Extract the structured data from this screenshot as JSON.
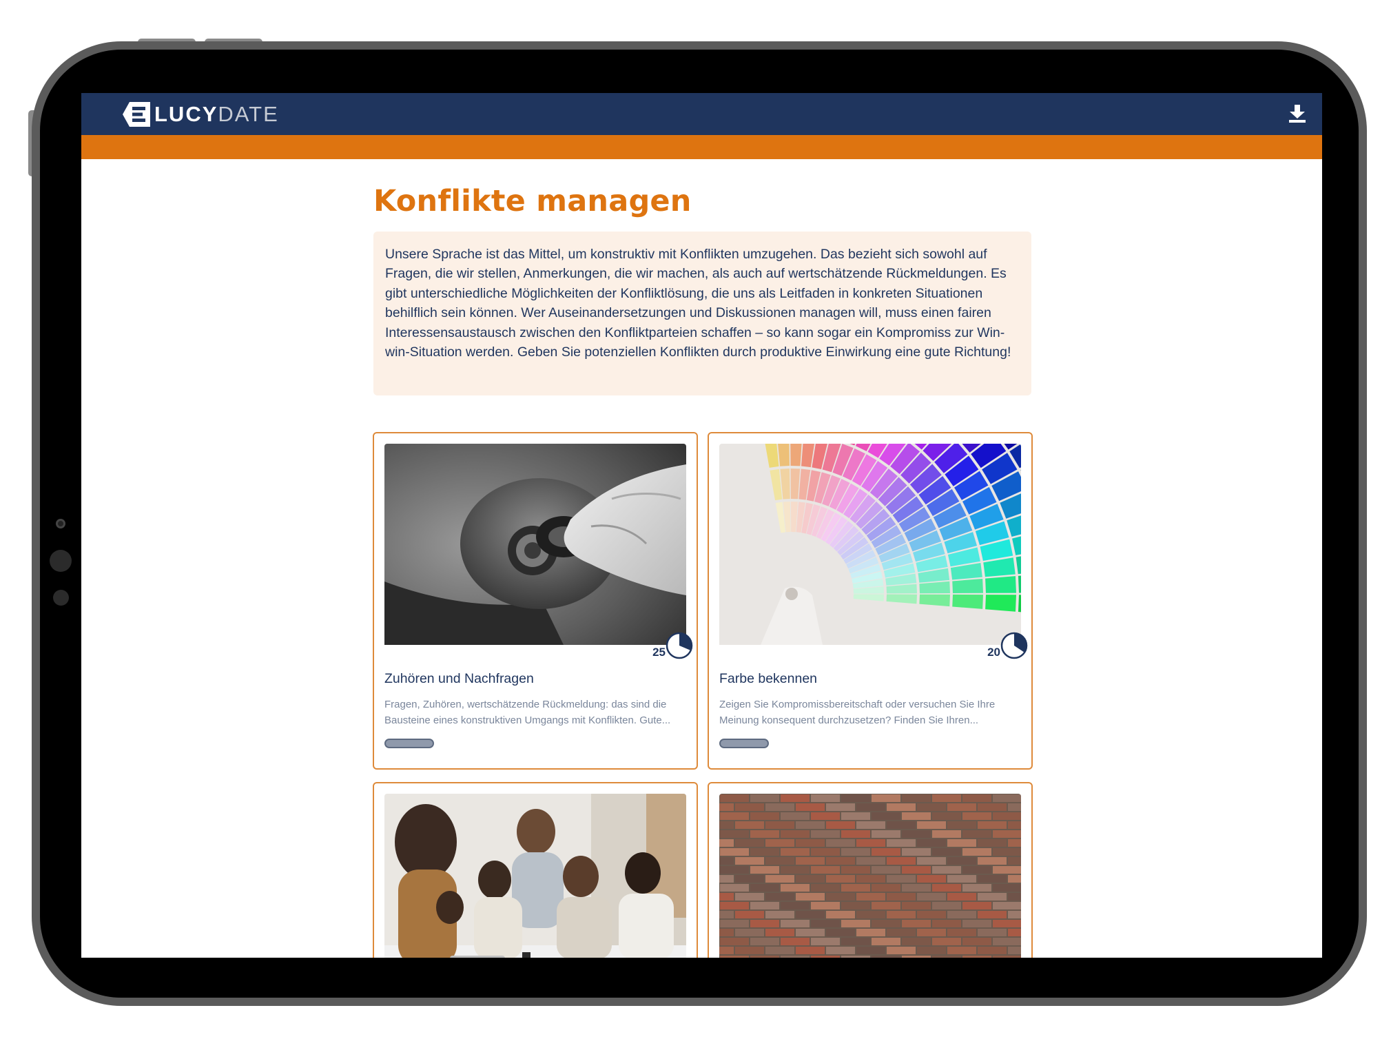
{
  "app": {
    "logo_text_bold": "LUCY",
    "logo_text_light": "DATE",
    "download_icon": "download-icon"
  },
  "colors": {
    "header_bg": "#1f355e",
    "accent": "#de7410",
    "intro_bg": "#fcf0e6",
    "text_primary": "#1f355e",
    "text_muted": "#7a869b"
  },
  "page": {
    "title": "Konflikte managen",
    "intro": "Unsere Sprache ist das Mittel, um konstruktiv mit Konflikten umzugehen. Das bezieht sich sowohl auf Fragen, die wir stellen, Anmerkungen, die wir machen, als auch auf wertschätzende Rückmeldungen. Es gibt unterschiedliche Möglichkeiten der Konfliktlösung, die uns als Leitfaden in konkreten Situationen behilflich sein können. Wer Auseinandersetzungen und Diskussionen managen will, muss einen fairen Interessensaustausch zwischen den Konfliktparteien schaffen – so kann sogar ein Kompromiss zur Win-win-Situation werden. Geben Sie potenziellen Konflikten durch produktive Einwirkung eine gute Richtung!"
  },
  "cards": [
    {
      "title": "Zuhören und Nachfragen",
      "description": "Fragen, Zuhören, wertschätzende Rückmeldung: das sind die Bausteine eines konstruktiven Umgangs mit Konflikten. Gute...",
      "duration": "25",
      "duration_icon": "clock-icon",
      "image": "key-in-ignition",
      "progress": 0
    },
    {
      "title": "Farbe bekennen",
      "description": "Zeigen Sie Kompromissbereitschaft oder versuchen Sie Ihre Meinung konsequent durchzusetzen? Finden Sie Ihren...",
      "duration": "20",
      "duration_icon": "clock-icon",
      "image": "color-fan",
      "progress": 0
    },
    {
      "title": "",
      "description": "",
      "image": "arguing-meeting"
    },
    {
      "title": "",
      "description": "",
      "image": "brick-wall"
    }
  ]
}
